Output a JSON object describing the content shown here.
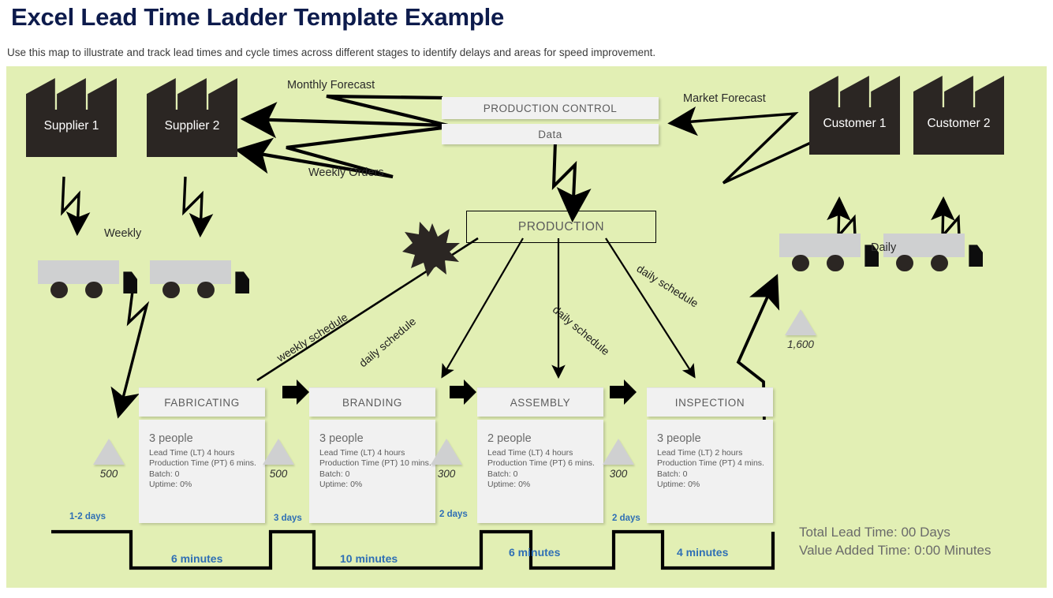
{
  "header": {
    "title": "Excel Lead Time Ladder Template Example",
    "subtitle": "Use this map to illustrate and track lead times and cycle times across different stages to identify delays and areas for speed improvement."
  },
  "colors": {
    "canvas_green": "#e2efb4",
    "title_navy": "#0d1b4c",
    "ladder_blue": "#2f6fb5",
    "box_gray": "#f1f1f1",
    "icon_dark": "#2b2623",
    "inventory_gray": "#cfd0d1"
  },
  "external_entities": [
    {
      "name": "supplier-1",
      "label": "Supplier 1"
    },
    {
      "name": "supplier-2",
      "label": "Supplier 2"
    },
    {
      "name": "customer-1",
      "label": "Customer 1"
    },
    {
      "name": "customer-2",
      "label": "Customer 2"
    }
  ],
  "control": {
    "production_control": "PRODUCTION CONTROL",
    "data": "Data",
    "production": "PRODUCTION"
  },
  "information_flow_labels": {
    "monthly_forecast": "Monthly Forecast",
    "weekly_orders": "Weekly Orders",
    "market_forecast": "Market Forecast",
    "weekly_shipment": "Weekly",
    "daily_shipment": "Daily",
    "schedule_weekly": "weekly schedule",
    "schedule_daily_1": "daily schedule",
    "schedule_daily_2": "daily schedule",
    "schedule_daily_3": "daily schedule"
  },
  "processes": [
    {
      "name": "fabricating",
      "title": "FABRICATING",
      "people": "3 people",
      "lead_time": "Lead Time (LT) 4 hours",
      "production_time": "Production Time (PT) 6 mins.",
      "batch": "Batch: 0",
      "uptime": "Uptime: 0%"
    },
    {
      "name": "branding",
      "title": "BRANDING",
      "people": "3 people",
      "lead_time": "Lead Time (LT) 4 hours",
      "production_time": "Production Time (PT) 10 mins.",
      "batch": "Batch: 0",
      "uptime": "Uptime: 0%"
    },
    {
      "name": "assembly",
      "title": "ASSEMBLY",
      "people": "2 people",
      "lead_time": "Lead Time (LT) 4 hours",
      "production_time": "Production Time (PT) 6 mins.",
      "batch": "Batch: 0",
      "uptime": "Uptime: 0%"
    },
    {
      "name": "inspection",
      "title": "INSPECTION",
      "people": "3 people",
      "lead_time": "Lead Time (LT) 2 hours",
      "production_time": "Production Time (PT) 4 mins.",
      "batch": "Batch: 0",
      "uptime": "Uptime: 0%"
    }
  ],
  "inventories": [
    {
      "name": "inventory-before-fabricating",
      "qty": "500"
    },
    {
      "name": "inventory-before-branding",
      "qty": "500"
    },
    {
      "name": "inventory-before-assembly",
      "qty": "300"
    },
    {
      "name": "inventory-before-inspection",
      "qty": "300"
    },
    {
      "name": "inventory-finished-goods",
      "qty": "1,600"
    }
  ],
  "timeline_ladder": {
    "wait_times": [
      "1-2 days",
      "3 days",
      "2 days",
      "2 days"
    ],
    "process_times": [
      "6 minutes",
      "10 minutes",
      "6 minutes",
      "4 minutes"
    ],
    "total_lead_time": "Total Lead Time: 00 Days",
    "value_added_time": "Value Added Time: 0:00 Minutes"
  }
}
